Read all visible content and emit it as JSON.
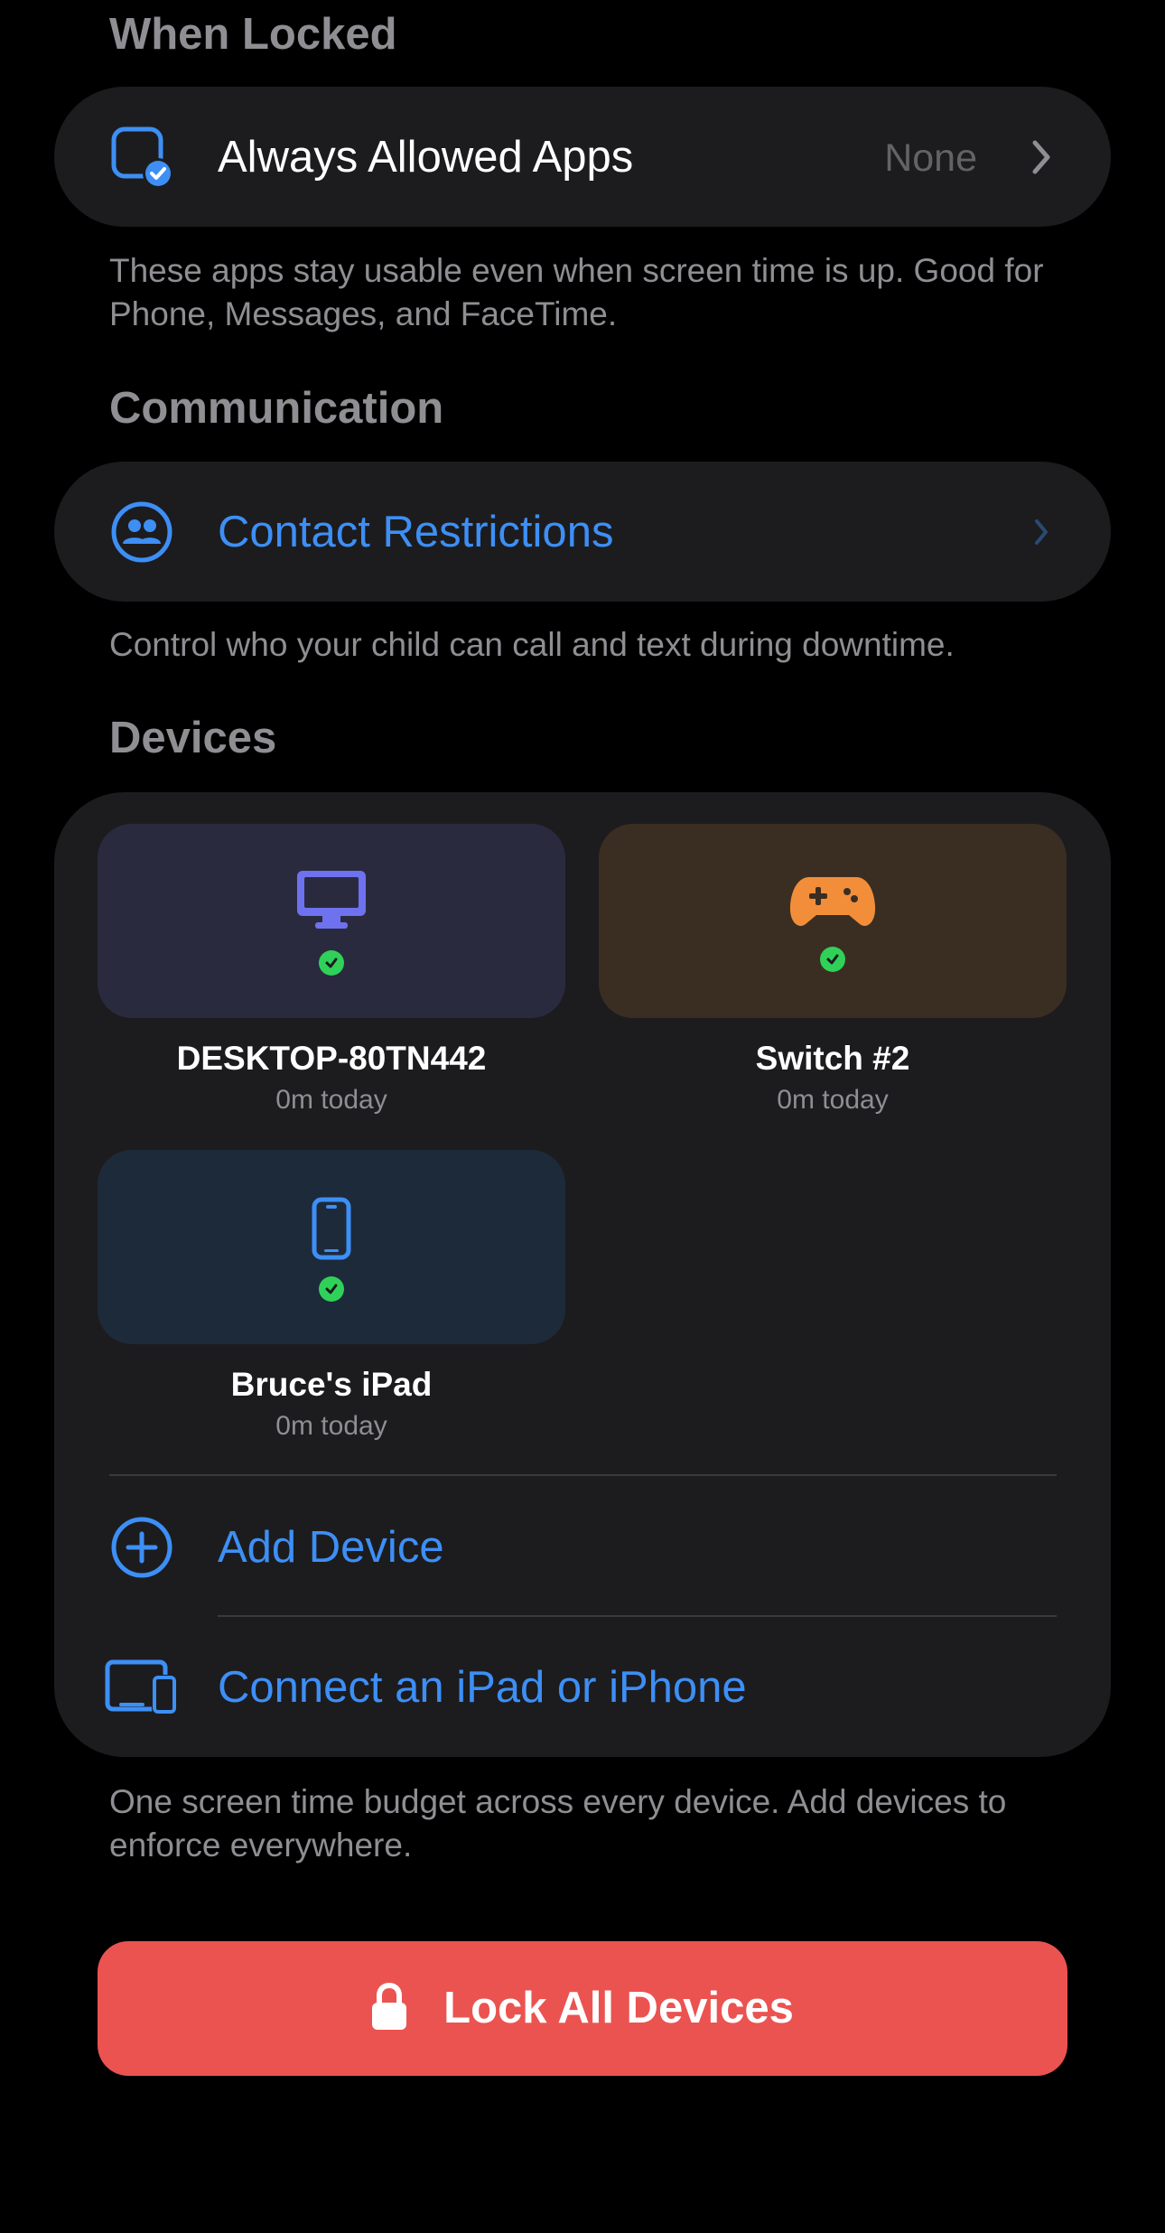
{
  "colors": {
    "background": "#000000",
    "card": "#1c1c1e",
    "accent": "#3d8ff5",
    "secondary_text": "#8e8e93",
    "success": "#30d158",
    "danger": "#eb5350",
    "desktop_tile": "#2a2a3f",
    "switch_tile": "#3a2e22",
    "ipad_tile": "#1d2a3a",
    "desktop_icon": "#6e72ee",
    "switch_icon": "#f28e3a"
  },
  "when_locked": {
    "header": "When Locked",
    "row": {
      "icon": "checkmark-app-icon",
      "label": "Always Allowed Apps",
      "value": "None"
    },
    "footnote": "These apps stay usable even when screen time is up. Good for Phone, Messages, and FaceTime."
  },
  "communication": {
    "header": "Communication",
    "row": {
      "icon": "people-icon",
      "label": "Contact Restrictions"
    },
    "footnote": "Control who your child can call and text during downtime."
  },
  "devices": {
    "header": "Devices",
    "items": [
      {
        "name": "DESKTOP-80TN442",
        "usage": "0m today",
        "icon": "desktop-icon",
        "status": "online"
      },
      {
        "name": "Switch #2",
        "usage": "0m today",
        "icon": "gamepad-icon",
        "status": "online"
      },
      {
        "name": "Bruce's iPad",
        "usage": "0m today",
        "icon": "phone-icon",
        "status": "online"
      }
    ],
    "add_device_label": "Add Device",
    "connect_label": "Connect an iPad or iPhone",
    "footnote": "One screen time budget across every device. Add devices to enforce everywhere."
  },
  "lock_button": {
    "label": "Lock All Devices",
    "icon": "lock-icon"
  }
}
